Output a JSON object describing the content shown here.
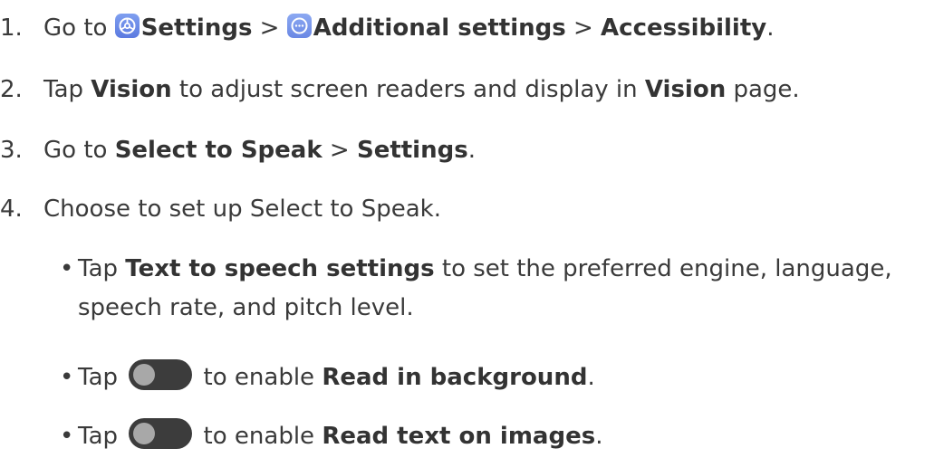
{
  "steps": [
    {
      "number": "1.",
      "parts": {
        "lead": "Go to ",
        "settings": "Settings",
        "sep1": " > ",
        "additional": "Additional settings",
        "sep2": " > ",
        "accessibility": "Accessibility",
        "end": "."
      }
    },
    {
      "number": "2.",
      "parts": {
        "lead": "Tap ",
        "vision1": "Vision",
        "mid": " to adjust screen readers and display in ",
        "vision2": "Vision",
        "end": " page."
      }
    },
    {
      "number": "3.",
      "parts": {
        "lead": "Go to ",
        "select": "Select to Speak",
        "sep": " > ",
        "settings": "Settings",
        "end": "."
      }
    },
    {
      "number": "4.",
      "parts": {
        "text": "Choose to set up Select to Speak."
      }
    }
  ],
  "bullets": [
    {
      "bullet": "•",
      "lead": "Tap ",
      "bold": "Text to speech settings",
      "rest1": " to set the preferred engine, language,",
      "rest2": "speech rate, and pitch level."
    },
    {
      "bullet": "•",
      "lead": "Tap ",
      "mid": " to enable ",
      "bold": "Read in background",
      "end": "."
    },
    {
      "bullet": "•",
      "lead": "Tap ",
      "mid": " to enable ",
      "bold": "Read text on images",
      "end": "."
    }
  ],
  "icons": {
    "settings": "settings-gear-icon",
    "additional": "more-dots-icon",
    "toggle": "toggle-switch-icon"
  },
  "colors": {
    "text": "#3a3a3a",
    "icon_blue": "#6a88e4",
    "toggle_track": "#3c3c3c",
    "toggle_knob": "#a8a8a8"
  }
}
